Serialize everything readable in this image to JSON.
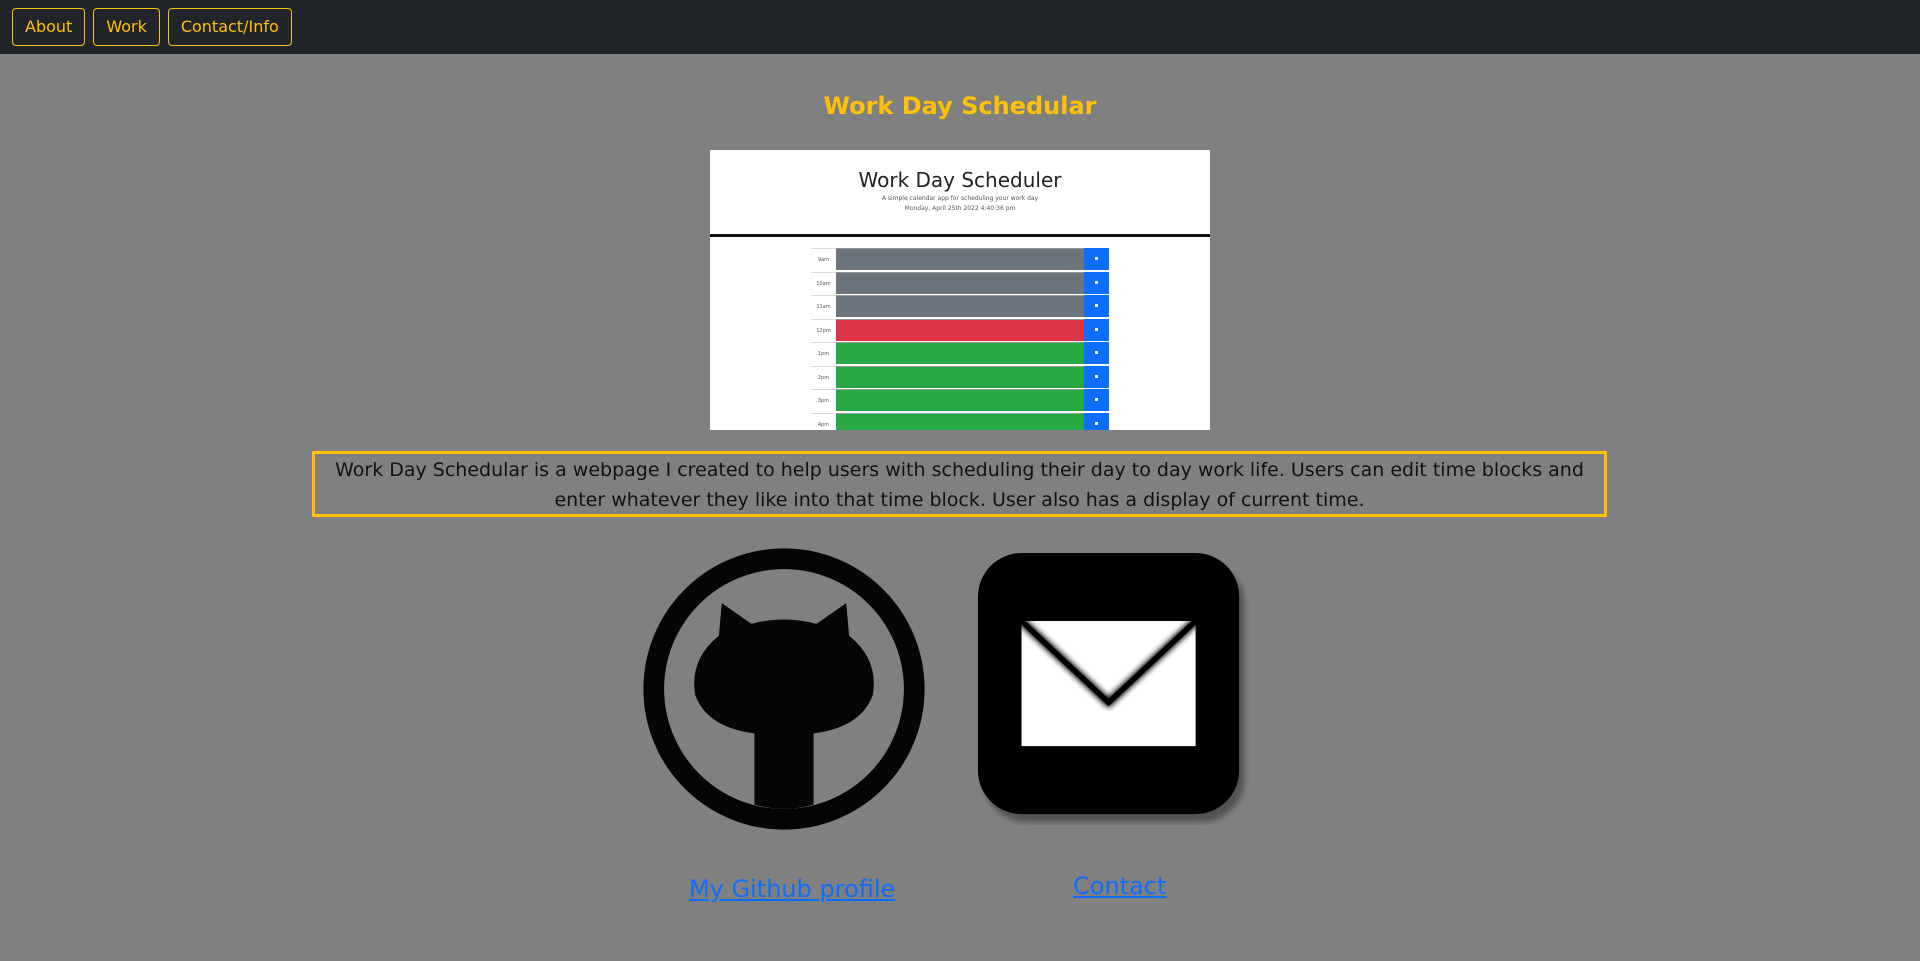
{
  "nav": {
    "items": [
      "About",
      "Work",
      "Contact/Info"
    ]
  },
  "project": {
    "title": "Work Day Schedular",
    "description": "Work Day Schedular is a webpage I created to help users with scheduling their day to day work life. Users can edit time blocks and enter whatever they like into that time block. User also has a display of current time."
  },
  "screenshot": {
    "title": "Work Day Scheduler",
    "subtitle": "A simple calendar app for scheduling your work day",
    "date": "Monday, April 25th 2022 4:40:36 pm",
    "hours": [
      "9am",
      "10am",
      "11am",
      "12pm",
      "1pm",
      "2pm",
      "3pm",
      "4pm"
    ],
    "states": [
      "past",
      "past",
      "past",
      "present",
      "future",
      "future",
      "future",
      "future"
    ],
    "save_icon": "save-icon"
  },
  "links": {
    "github": "My Github profile",
    "contact": "Contact"
  },
  "icons": {
    "github": "github-icon",
    "mail": "mail-icon"
  },
  "colors": {
    "accent": "#ffc107",
    "background": "#808080",
    "navbar": "#212529",
    "link": "#0d6efd",
    "past": "#6c757d",
    "present": "#dc3545",
    "future": "#28a745"
  }
}
